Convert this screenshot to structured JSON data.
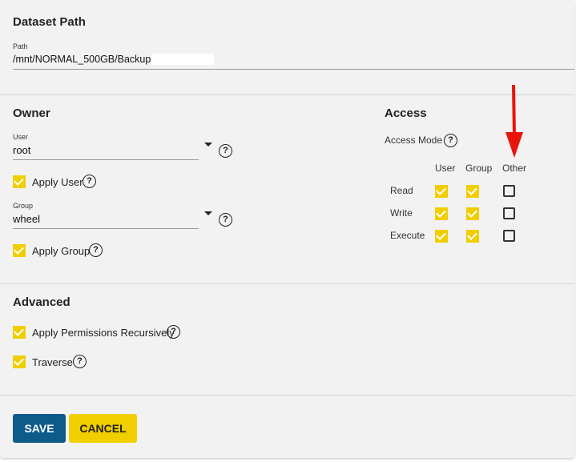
{
  "dataset_path": {
    "title": "Dataset Path",
    "path_label": "Path",
    "path_value": "/mnt/NORMAL_500GB/Backups/"
  },
  "owner": {
    "title": "Owner",
    "user_label": "User",
    "user_value": "root",
    "apply_user_label": "Apply User",
    "apply_user_checked": true,
    "group_label": "Group",
    "group_value": "wheel",
    "apply_group_label": "Apply Group",
    "apply_group_checked": true
  },
  "access": {
    "title": "Access",
    "mode_label": "Access Mode",
    "columns": [
      "User",
      "Group",
      "Other"
    ],
    "rows": [
      {
        "label": "Read",
        "user": true,
        "group": true,
        "other": false
      },
      {
        "label": "Write",
        "user": true,
        "group": true,
        "other": false
      },
      {
        "label": "Execute",
        "user": true,
        "group": true,
        "other": false
      }
    ]
  },
  "advanced": {
    "title": "Advanced",
    "recursive_label": "Apply Permissions Recursively",
    "recursive_checked": true,
    "traverse_label": "Traverse",
    "traverse_checked": true
  },
  "actions": {
    "save_label": "SAVE",
    "cancel_label": "CANCEL"
  },
  "annotation": {
    "arrow_color": "#e8140c"
  },
  "colors": {
    "accent_yellow": "#f0ce00",
    "primary_blue": "#0e5b8a"
  }
}
